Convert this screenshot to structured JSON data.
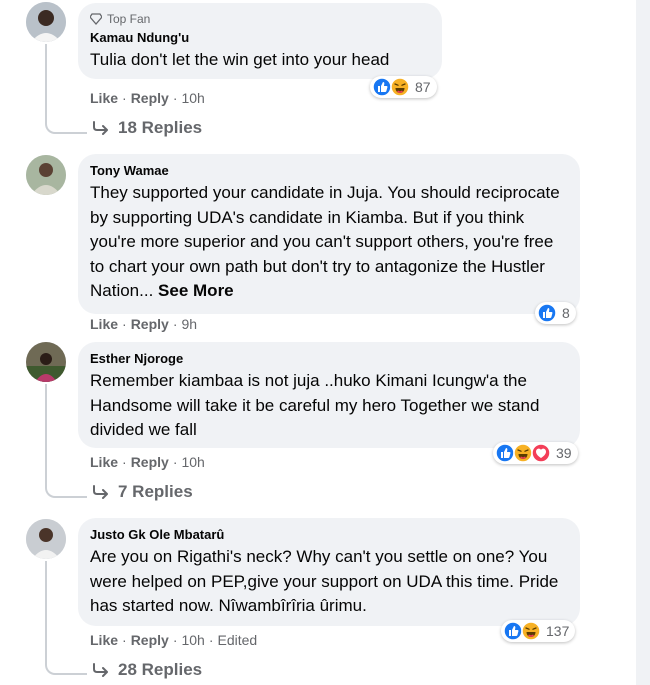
{
  "comments": [
    {
      "badge": "Top Fan",
      "author": "Kamau Ndung'u",
      "text": "Tulia don't let the win get into your head",
      "like": "Like",
      "reply": "Reply",
      "time": "10h",
      "edited": "",
      "reaction_icons": [
        "like-reaction",
        "haha-reaction"
      ],
      "reaction_count": "87",
      "replies": "18 Replies"
    },
    {
      "badge": "",
      "author": "Tony Wamae",
      "text": "They supported your candidate in Juja. You should reciprocate by supporting UDA's candidate in Kiamba. But if you think you're more superior and you can't support others, you're free to chart your own path but don't try to antagonize the Hustler Nation... ",
      "see_more": "See More",
      "like": "Like",
      "reply": "Reply",
      "time": "9h",
      "edited": "",
      "reaction_icons": [
        "like-reaction"
      ],
      "reaction_count": "8",
      "replies": ""
    },
    {
      "badge": "",
      "author": "Esther Njoroge",
      "text": "Remember kiambaa is not juja ..huko Kimani Icungw'a the Handsome will take it be careful my hero Together we stand divided we fall",
      "like": "Like",
      "reply": "Reply",
      "time": "10h",
      "edited": "",
      "reaction_icons": [
        "like-reaction",
        "haha-reaction",
        "love-reaction"
      ],
      "reaction_count": "39",
      "replies": "7 Replies"
    },
    {
      "badge": "",
      "author": "Justo Gk Ole Mbatarû",
      "text": "Are you on Rigathi's neck? Why can't you settle on one? You were helped on PEP,give your support on UDA this time. Pride has started now. Nîwambîrîria ûrimu.",
      "like": "Like",
      "reply": "Reply",
      "time": "10h",
      "edited": "Edited",
      "reaction_icons": [
        "like-reaction",
        "haha-reaction"
      ],
      "reaction_count": "137",
      "replies": "28 Replies"
    }
  ],
  "colors": {
    "like_blue": "#1877f2",
    "haha_yellow": "#f7b125",
    "love_red": "#f33e58",
    "secondary_text": "#65676b",
    "bubble_bg": "#f0f2f5"
  }
}
